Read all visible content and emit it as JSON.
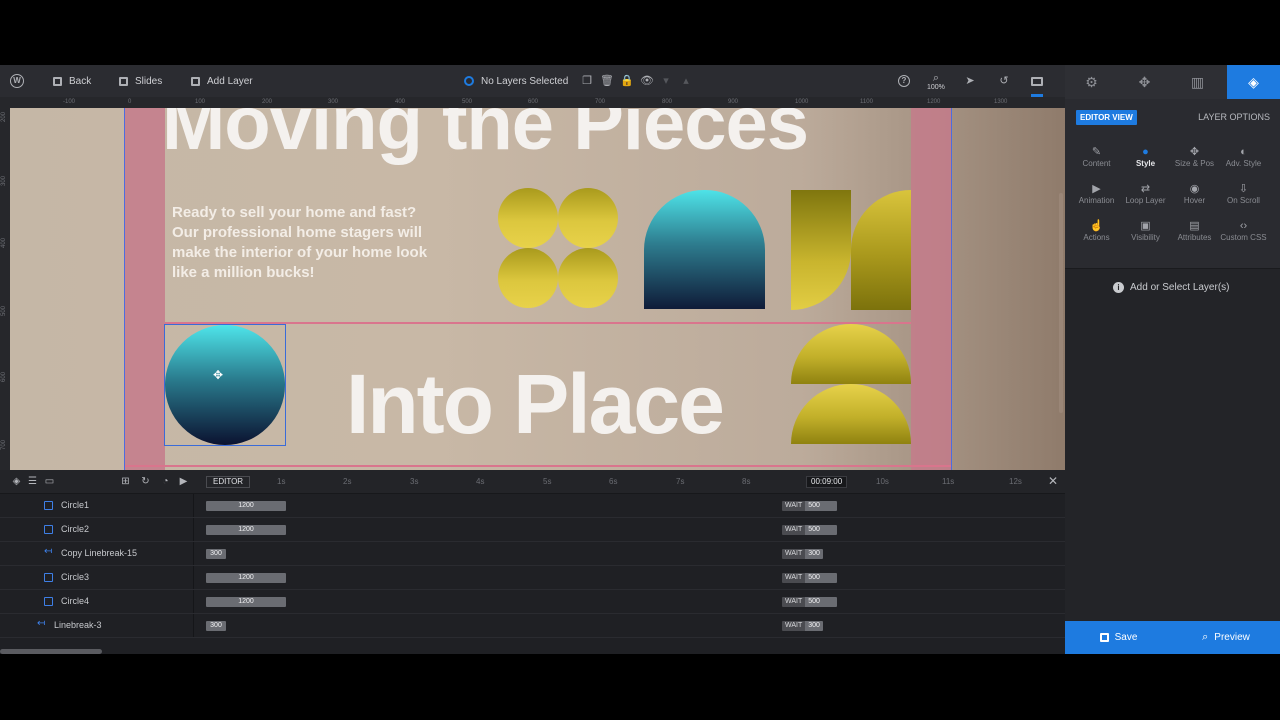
{
  "toolbar": {
    "back_label": "Back",
    "slides_label": "Slides",
    "add_layer_label": "Add Layer",
    "layers_selected": "No Layers Selected",
    "zoom_level": "100%"
  },
  "ruler": {
    "top_ticks": [
      "-100",
      "0",
      "100",
      "200",
      "300",
      "400",
      "500",
      "600",
      "700",
      "800",
      "900",
      "1000",
      "1100",
      "1200",
      "1300"
    ],
    "left_ticks": [
      "200",
      "300",
      "400",
      "500",
      "600",
      "700"
    ]
  },
  "canvas": {
    "headline1": "Moving the Pieces",
    "headline2": "Into Place",
    "paragraph": "Ready to sell your home and fast? Our professional home stagers will make the interior of your home look like a million bucks!"
  },
  "panel": {
    "tabs": [
      "settings-icon",
      "navigation-icon",
      "slides-icon",
      "layers-icon"
    ],
    "editor_view_label": "EDITOR VIEW",
    "layer_options_label": "LAYER OPTIONS",
    "options": [
      {
        "label": "Content",
        "icon": "pencil-icon",
        "glyph": "✎"
      },
      {
        "label": "Style",
        "icon": "palette-icon",
        "glyph": "●"
      },
      {
        "label": "Size & Pos",
        "icon": "move-icon",
        "glyph": "✥"
      },
      {
        "label": "Adv. Style",
        "icon": "contrast-icon",
        "glyph": "◐"
      },
      {
        "label": "Animation",
        "icon": "play-icon",
        "glyph": "▶"
      },
      {
        "label": "Loop Layer",
        "icon": "loop-icon",
        "glyph": "⇄"
      },
      {
        "label": "Hover",
        "icon": "mouse-icon",
        "glyph": "◉"
      },
      {
        "label": "On Scroll",
        "icon": "scroll-icon",
        "glyph": "⇩"
      },
      {
        "label": "Actions",
        "icon": "pointer-icon",
        "glyph": "☝"
      },
      {
        "label": "Visibility",
        "icon": "visibility-icon",
        "glyph": "▣"
      },
      {
        "label": "Attributes",
        "icon": "document-icon",
        "glyph": "▤"
      },
      {
        "label": "Custom CSS",
        "icon": "code-icon",
        "glyph": "‹›"
      }
    ],
    "add_select_label": "Add or Select Layer(s)",
    "save_label": "Save",
    "preview_label": "Preview"
  },
  "timeline": {
    "editor_tag": "EDITOR",
    "time_ticks": [
      "1s",
      "2s",
      "3s",
      "4s",
      "5s",
      "6s",
      "7s",
      "8s",
      "9s",
      "10s",
      "11s",
      "12s"
    ],
    "current_time": "00:09:00",
    "wait_label": "WAIT",
    "rows": [
      {
        "name": "Circle1",
        "type": "shape",
        "duration": "1200",
        "wait": "500"
      },
      {
        "name": "Circle2",
        "type": "shape",
        "duration": "1200",
        "wait": "500"
      },
      {
        "name": "Copy Linebreak-15",
        "type": "linebreak",
        "duration": "300",
        "wait": "300"
      },
      {
        "name": "Circle3",
        "type": "shape",
        "duration": "1200",
        "wait": "500"
      },
      {
        "name": "Circle4",
        "type": "shape",
        "duration": "1200",
        "wait": "500"
      },
      {
        "name": "Linebreak-3",
        "type": "linebreak",
        "duration": "300",
        "wait": "300"
      }
    ]
  },
  "colors": {
    "accent": "#1e7be0",
    "canvas_bg": "#c5b7a6",
    "pink_strip": "#c47b8b",
    "yellow_shape": "#dcc73e",
    "cyan_shape": "#4ee3e8",
    "navy_shape": "#0f1b38"
  }
}
